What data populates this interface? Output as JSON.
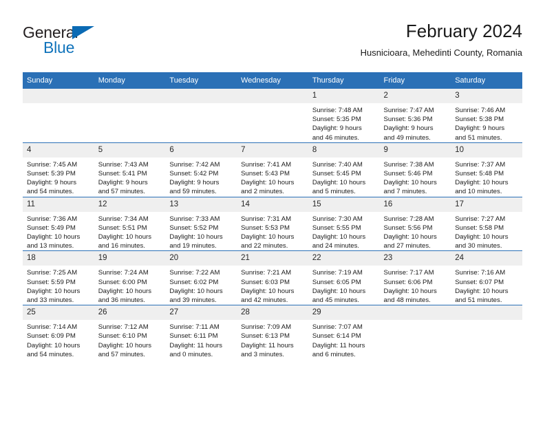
{
  "logo": {
    "word1": "General",
    "word2": "Blue",
    "triangle_color": "#0a6ab4",
    "blue_color": "#1073bb"
  },
  "header": {
    "title": "February 2024",
    "subtitle": "Husnicioara, Mehedinti County, Romania"
  },
  "theme": {
    "header_blue": "#2b70b6",
    "daynum_bg": "#efefef",
    "text": "#1a1a1a"
  },
  "weekdays": [
    "Sunday",
    "Monday",
    "Tuesday",
    "Wednesday",
    "Thursday",
    "Friday",
    "Saturday"
  ],
  "labels": {
    "sunrise_prefix": "Sunrise: ",
    "sunset_prefix": "Sunset: ",
    "daylight_prefix": "Daylight: "
  },
  "weeks": [
    [
      {
        "day": ""
      },
      {
        "day": ""
      },
      {
        "day": ""
      },
      {
        "day": ""
      },
      {
        "day": "1",
        "sunrise": "Sunrise: 7:48 AM",
        "sunset": "Sunset: 5:35 PM",
        "daylight1": "Daylight: 9 hours",
        "daylight2": "and 46 minutes."
      },
      {
        "day": "2",
        "sunrise": "Sunrise: 7:47 AM",
        "sunset": "Sunset: 5:36 PM",
        "daylight1": "Daylight: 9 hours",
        "daylight2": "and 49 minutes."
      },
      {
        "day": "3",
        "sunrise": "Sunrise: 7:46 AM",
        "sunset": "Sunset: 5:38 PM",
        "daylight1": "Daylight: 9 hours",
        "daylight2": "and 51 minutes."
      }
    ],
    [
      {
        "day": "4",
        "sunrise": "Sunrise: 7:45 AM",
        "sunset": "Sunset: 5:39 PM",
        "daylight1": "Daylight: 9 hours",
        "daylight2": "and 54 minutes."
      },
      {
        "day": "5",
        "sunrise": "Sunrise: 7:43 AM",
        "sunset": "Sunset: 5:41 PM",
        "daylight1": "Daylight: 9 hours",
        "daylight2": "and 57 minutes."
      },
      {
        "day": "6",
        "sunrise": "Sunrise: 7:42 AM",
        "sunset": "Sunset: 5:42 PM",
        "daylight1": "Daylight: 9 hours",
        "daylight2": "and 59 minutes."
      },
      {
        "day": "7",
        "sunrise": "Sunrise: 7:41 AM",
        "sunset": "Sunset: 5:43 PM",
        "daylight1": "Daylight: 10 hours",
        "daylight2": "and 2 minutes."
      },
      {
        "day": "8",
        "sunrise": "Sunrise: 7:40 AM",
        "sunset": "Sunset: 5:45 PM",
        "daylight1": "Daylight: 10 hours",
        "daylight2": "and 5 minutes."
      },
      {
        "day": "9",
        "sunrise": "Sunrise: 7:38 AM",
        "sunset": "Sunset: 5:46 PM",
        "daylight1": "Daylight: 10 hours",
        "daylight2": "and 7 minutes."
      },
      {
        "day": "10",
        "sunrise": "Sunrise: 7:37 AM",
        "sunset": "Sunset: 5:48 PM",
        "daylight1": "Daylight: 10 hours",
        "daylight2": "and 10 minutes."
      }
    ],
    [
      {
        "day": "11",
        "sunrise": "Sunrise: 7:36 AM",
        "sunset": "Sunset: 5:49 PM",
        "daylight1": "Daylight: 10 hours",
        "daylight2": "and 13 minutes."
      },
      {
        "day": "12",
        "sunrise": "Sunrise: 7:34 AM",
        "sunset": "Sunset: 5:51 PM",
        "daylight1": "Daylight: 10 hours",
        "daylight2": "and 16 minutes."
      },
      {
        "day": "13",
        "sunrise": "Sunrise: 7:33 AM",
        "sunset": "Sunset: 5:52 PM",
        "daylight1": "Daylight: 10 hours",
        "daylight2": "and 19 minutes."
      },
      {
        "day": "14",
        "sunrise": "Sunrise: 7:31 AM",
        "sunset": "Sunset: 5:53 PM",
        "daylight1": "Daylight: 10 hours",
        "daylight2": "and 22 minutes."
      },
      {
        "day": "15",
        "sunrise": "Sunrise: 7:30 AM",
        "sunset": "Sunset: 5:55 PM",
        "daylight1": "Daylight: 10 hours",
        "daylight2": "and 24 minutes."
      },
      {
        "day": "16",
        "sunrise": "Sunrise: 7:28 AM",
        "sunset": "Sunset: 5:56 PM",
        "daylight1": "Daylight: 10 hours",
        "daylight2": "and 27 minutes."
      },
      {
        "day": "17",
        "sunrise": "Sunrise: 7:27 AM",
        "sunset": "Sunset: 5:58 PM",
        "daylight1": "Daylight: 10 hours",
        "daylight2": "and 30 minutes."
      }
    ],
    [
      {
        "day": "18",
        "sunrise": "Sunrise: 7:25 AM",
        "sunset": "Sunset: 5:59 PM",
        "daylight1": "Daylight: 10 hours",
        "daylight2": "and 33 minutes."
      },
      {
        "day": "19",
        "sunrise": "Sunrise: 7:24 AM",
        "sunset": "Sunset: 6:00 PM",
        "daylight1": "Daylight: 10 hours",
        "daylight2": "and 36 minutes."
      },
      {
        "day": "20",
        "sunrise": "Sunrise: 7:22 AM",
        "sunset": "Sunset: 6:02 PM",
        "daylight1": "Daylight: 10 hours",
        "daylight2": "and 39 minutes."
      },
      {
        "day": "21",
        "sunrise": "Sunrise: 7:21 AM",
        "sunset": "Sunset: 6:03 PM",
        "daylight1": "Daylight: 10 hours",
        "daylight2": "and 42 minutes."
      },
      {
        "day": "22",
        "sunrise": "Sunrise: 7:19 AM",
        "sunset": "Sunset: 6:05 PM",
        "daylight1": "Daylight: 10 hours",
        "daylight2": "and 45 minutes."
      },
      {
        "day": "23",
        "sunrise": "Sunrise: 7:17 AM",
        "sunset": "Sunset: 6:06 PM",
        "daylight1": "Daylight: 10 hours",
        "daylight2": "and 48 minutes."
      },
      {
        "day": "24",
        "sunrise": "Sunrise: 7:16 AM",
        "sunset": "Sunset: 6:07 PM",
        "daylight1": "Daylight: 10 hours",
        "daylight2": "and 51 minutes."
      }
    ],
    [
      {
        "day": "25",
        "sunrise": "Sunrise: 7:14 AM",
        "sunset": "Sunset: 6:09 PM",
        "daylight1": "Daylight: 10 hours",
        "daylight2": "and 54 minutes."
      },
      {
        "day": "26",
        "sunrise": "Sunrise: 7:12 AM",
        "sunset": "Sunset: 6:10 PM",
        "daylight1": "Daylight: 10 hours",
        "daylight2": "and 57 minutes."
      },
      {
        "day": "27",
        "sunrise": "Sunrise: 7:11 AM",
        "sunset": "Sunset: 6:11 PM",
        "daylight1": "Daylight: 11 hours",
        "daylight2": "and 0 minutes."
      },
      {
        "day": "28",
        "sunrise": "Sunrise: 7:09 AM",
        "sunset": "Sunset: 6:13 PM",
        "daylight1": "Daylight: 11 hours",
        "daylight2": "and 3 minutes."
      },
      {
        "day": "29",
        "sunrise": "Sunrise: 7:07 AM",
        "sunset": "Sunset: 6:14 PM",
        "daylight1": "Daylight: 11 hours",
        "daylight2": "and 6 minutes."
      },
      {
        "day": ""
      },
      {
        "day": ""
      }
    ]
  ]
}
